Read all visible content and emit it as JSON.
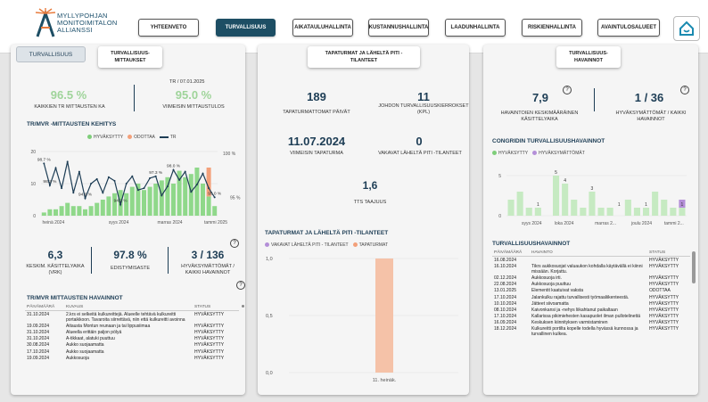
{
  "header": {
    "logo_lines": [
      "MYLLYPOHJAN",
      "MONITOIMITALON",
      "ALLIANSSI"
    ],
    "nav": [
      "YHTEENVETO",
      "TURVALLISUUS",
      "AIKATAULUHALLINTA",
      "KUSTANNUSHALLINTA",
      "LAADUNHALLINTA",
      "RISKIENHALLINTA",
      "AVAINTULOSALUEET"
    ],
    "active_index": 1
  },
  "left": {
    "tab1": "TURVALLISUUS",
    "tab2": "TURVALLISUUS-MITTAUKSET",
    "date_line": "TR   /  07.01.2025",
    "kpi1_value": "96.5 %",
    "kpi1_label": "KAIKKIEN TR MITTAUSTEN KA",
    "kpi2_value": "95.0 %",
    "kpi2_label": "VIIMEISIN MITTAUSTULOS",
    "chart_title": "TR/MVR -MITTAUSTEN KEHITYS",
    "legend": [
      "HYVÄKSYTTY",
      "ODOTTAA",
      "TR"
    ],
    "kpi3_value": "6,3",
    "kpi3_label": "KESKIM. KÄSITTELYAIKA (VRK)",
    "kpi4_value": "97.8 %",
    "kpi4_label": "EDISTYMISASTE",
    "kpi5_value": "3  / 136",
    "kpi5_label": "HYVÄKSYMÄTTÖMÄT / KAIKKI HAVAINNOT",
    "table_title": "TR/MVR MITTAUSTEN HAVAINNOT",
    "cols": [
      "PÄIVÄMÄÄRÄ",
      "KUVAUS",
      "STATUS"
    ],
    "rows": [
      [
        "31.10.2024",
        "2.krs ei selkeitä kulkureittejä. Alueelle tehtävä kulkureitti portaikkoon. Tavaroita siirrettävä, niin että kulkureitti avoinna",
        "HYVÄKSYTTY"
      ],
      [
        "19.09.2024",
        "Aitausta Montun reunaan ja tai lippusiimaa",
        "HYVÄKSYTTY"
      ],
      [
        "31.10.2024",
        "Alueella erittäin paljon pölyä",
        "HYVÄKSYTTY"
      ],
      [
        "31.10.2024",
        "A-tikkaat, alatuki puuttuu",
        "HYVÄKSYTTY"
      ],
      [
        "30.08.2024",
        "Aukko suojaamatta",
        "HYVÄKSYTTY"
      ],
      [
        "17.10.2024",
        "Aukko suojaamatta",
        "HYVÄKSYTTY"
      ],
      [
        "19.09.2024",
        "Aukkosuoja",
        "HYVÄKSYTTY"
      ]
    ]
  },
  "middle": {
    "tab": "TAPATURMAT JA LÄHELTÄ PITI -TILANTEET",
    "k1_value": "189",
    "k1_label": "TAPATURMATTOMAT PÄIVÄT",
    "k2_value": "11",
    "k2_label": "JOHDON TURVALLISUUSKIERROKSET (KPL)",
    "k3_value": "11.07.2024",
    "k3_label": "VIIMEISIN TAPATURMA",
    "k4_value": "0",
    "k4_label": "VAKAVAT LÄHELTÄ PITI -TILANTEET",
    "k5_value": "1,6",
    "k5_label": "TTS TAAJUUS",
    "chart_title": "TAPATURMAT JA LÄHELTÄ PITI -TILANTEET",
    "legend": [
      "VAKAVAT LÄHELTÄ PITI - TILANTEET",
      "TAPATURMAT"
    ]
  },
  "right": {
    "tab": "TURVALLISUUS-HAVAINNOT",
    "k1_value": "7,9",
    "k1_label": "HAVAINTOIEN KESKIMÄÄRÄINEN KÄSITTELYAIKA",
    "k2_value": "1  /  36",
    "k2_label": "HYVÄKSYMÄTTÖMÄT / KAIKKI HAVAINNOT",
    "chart_title": "CONGRIDIN TURVALLISUUSHAVAINNOT",
    "legend": [
      "HYVÄKSYTTY",
      "HYVÄKSYMÄTTÖMÄT"
    ],
    "table_title": "TURVALLISUUSHAVAINNOT",
    "cols": [
      "PÄIVÄMÄÄRÄ",
      "HAVAINTO",
      "STATUS"
    ],
    "rows": [
      [
        "16.08.2024",
        "",
        "HYVÄKSYTTY"
      ],
      [
        "16.10.2024",
        "Tikrs aukkosuojat valuaukon kohdalla käytävällä ei kiinni missään. Korjattu.",
        "HYVÄKSYTTY"
      ],
      [
        "02.12.2024",
        "Aukkosuoja irti.",
        "HYVÄKSYTTY"
      ],
      [
        "22.08.2024",
        "Aukkosuoja puuttuu",
        "HYVÄKSYTTY"
      ],
      [
        "13.01.2025",
        "Elementit kaatuivat vaksta",
        "ODOTTAA"
      ],
      [
        "17.10.2024",
        "Jalankulku rajattu turvallisesti työmaaliikenteestä.",
        "HYVÄKSYTTY"
      ],
      [
        "10.10.2024",
        "Jätteet siivoamatta",
        "HYVÄKSYTTY"
      ],
      [
        "08.10.2024",
        "Kaivonkansi ja -nehys liikahtanut paikaltaan",
        "HYVÄKSYTTY"
      ],
      [
        "17.10.2024",
        "Kallarissa pikimiehesten kasapuolet ilman pullotelinettä",
        "HYVÄKSYTTY"
      ],
      [
        "16.09.2024",
        "Keskuksen kiinnityksen varmistaminen",
        "HYVÄKSYTTY"
      ],
      [
        "18.12.2024",
        "Kulkureitti portilta kopelle todella hyvässä kunnossa ja turvallinen kulkea.",
        "HYVÄKSYTTY"
      ]
    ]
  },
  "chart_data": [
    {
      "type": "line",
      "title": "TR/MVR -MITTAUSTEN KEHITYS",
      "series": [
        {
          "name": "TR",
          "values": [
            98.7,
            96.3,
            98.2,
            96.0,
            98.9,
            95.5,
            97.8,
            94.9,
            96.5,
            97.0,
            95.5,
            97.2,
            96.8,
            94.2,
            96.5,
            97.3,
            95.8,
            96.0,
            97.1,
            97.3,
            95.2,
            96.2,
            98.0,
            96.9,
            97.8,
            95.6,
            96.4,
            97.6,
            96.0,
            95.0
          ]
        },
        {
          "name": "HYVÄKSYTTY",
          "values": [
            1,
            2,
            2,
            3,
            4,
            3,
            3,
            2,
            3,
            4,
            5,
            6,
            7,
            8,
            7,
            9,
            10,
            8,
            9,
            10,
            11,
            12,
            10,
            14,
            12,
            13,
            15,
            10,
            6,
            3
          ]
        },
        {
          "name": "ODOTTAA",
          "values": [
            0,
            0,
            0,
            0,
            0,
            0,
            0,
            0,
            0,
            0,
            0,
            0,
            0,
            0,
            0,
            0,
            0,
            0,
            0,
            0,
            0,
            0,
            0,
            0,
            0,
            0,
            0,
            0,
            9,
            0
          ]
        }
      ],
      "x_ticks": [
        "heinä 2024",
        "syys 2024",
        "marras 2024",
        "tammi 2025"
      ],
      "y_left": [
        0,
        10,
        20
      ],
      "y_right": [
        "100 %",
        "95 %"
      ],
      "annotations": [
        "98.7 %",
        "98.3 %",
        "94.9 %",
        "94.2 %",
        "97.3 %",
        "98.0 %",
        "95.0 %"
      ]
    },
    {
      "type": "bar",
      "title": "TAPATURMAT JA LÄHELTÄ PITI -TILANTEET",
      "categories": [
        "11. heinäk."
      ],
      "series": [
        {
          "name": "TAPATURMAT",
          "values": [
            1
          ]
        },
        {
          "name": "VAKAVAT LÄHELTÄ PITI - TILANTEET",
          "values": [
            0
          ]
        }
      ],
      "ylim": [
        0,
        1
      ],
      "y_ticks": [
        "0,0",
        "0,5",
        "1,0"
      ]
    },
    {
      "type": "bar",
      "title": "CONGRIDIN TURVALLISUUSHAVAINNOT",
      "categories": [
        "syys 2024",
        "loka 2024",
        "marras 2...",
        "joulu 2024",
        "tammi 2..."
      ],
      "series": [
        {
          "name": "HYVÄKSYTTY",
          "values": [
            2,
            3,
            1,
            1,
            0,
            5,
            4,
            2,
            1,
            3,
            1,
            1,
            0,
            2,
            1,
            1,
            3,
            2,
            1,
            1
          ]
        },
        {
          "name": "HYVÄKSYMÄTTÖMÄT",
          "values": [
            0,
            0,
            0,
            0,
            0,
            0,
            0,
            0,
            0,
            0,
            0,
            0,
            0,
            0,
            0,
            0,
            0,
            0,
            0,
            1
          ]
        }
      ],
      "labels": [
        "5",
        "4",
        "3",
        "1",
        "1",
        "1",
        "1"
      ],
      "y_ticks": [
        "0",
        "5"
      ]
    }
  ]
}
